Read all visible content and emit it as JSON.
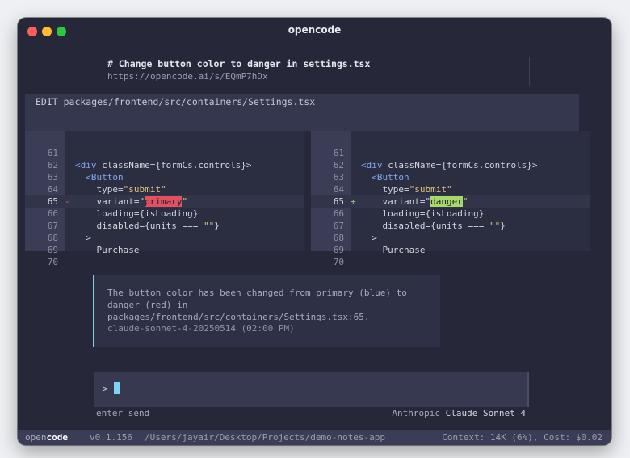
{
  "window": {
    "title": "opencode"
  },
  "message": {
    "title": "# Change button color to danger in settings.tsx",
    "share_url": "https://opencode.ai/s/EQmP7hDx"
  },
  "edit": {
    "header": "EDIT packages/frontend/src/containers/Settings.tsx"
  },
  "diff": {
    "left": [
      {
        "num": "61",
        "mark": "",
        "pre": "",
        "word": "",
        "post": ""
      },
      {
        "num": "62",
        "mark": "",
        "pre": "<div className={formCs.controls}>",
        "word": "",
        "post": ""
      },
      {
        "num": "63",
        "mark": "",
        "pre": "  <Button",
        "word": "",
        "post": ""
      },
      {
        "num": "64",
        "mark": "",
        "pre": "    type=\"submit\"",
        "word": "",
        "post": ""
      },
      {
        "num": "65",
        "mark": "-",
        "pre": "    variant=\"",
        "word": "primary",
        "post": "\""
      },
      {
        "num": "66",
        "mark": "",
        "pre": "    loading={isLoading}",
        "word": "",
        "post": ""
      },
      {
        "num": "67",
        "mark": "",
        "pre": "    disabled={units === \"\"}",
        "word": "",
        "post": ""
      },
      {
        "num": "68",
        "mark": "",
        "pre": "  >",
        "word": "",
        "post": ""
      },
      {
        "num": "69",
        "mark": "",
        "pre": "    Purchase",
        "word": "",
        "post": ""
      },
      {
        "num": "70",
        "mark": "",
        "pre": "",
        "word": "",
        "post": ""
      }
    ],
    "right": [
      {
        "num": "61",
        "mark": "",
        "pre": "",
        "word": "",
        "post": ""
      },
      {
        "num": "62",
        "mark": "",
        "pre": "<div className={formCs.controls}>",
        "word": "",
        "post": ""
      },
      {
        "num": "63",
        "mark": "",
        "pre": "  <Button",
        "word": "",
        "post": ""
      },
      {
        "num": "64",
        "mark": "",
        "pre": "    type=\"submit\"",
        "word": "",
        "post": ""
      },
      {
        "num": "65",
        "mark": "+",
        "pre": "    variant=\"",
        "word": "danger",
        "post": "\""
      },
      {
        "num": "66",
        "mark": "",
        "pre": "    loading={isLoading}",
        "word": "",
        "post": ""
      },
      {
        "num": "67",
        "mark": "",
        "pre": "    disabled={units === \"\"}",
        "word": "",
        "post": ""
      },
      {
        "num": "68",
        "mark": "",
        "pre": "  >",
        "word": "",
        "post": ""
      },
      {
        "num": "69",
        "mark": "",
        "pre": "    Purchase",
        "word": "",
        "post": ""
      },
      {
        "num": "70",
        "mark": "",
        "pre": "",
        "word": "",
        "post": ""
      }
    ]
  },
  "response": {
    "text": "The button color has been changed from primary (blue) to danger (red) in packages/frontend/src/containers/Settings.tsx:65.",
    "meta": "claude-sonnet-4-20250514 (02:00 PM)"
  },
  "input": {
    "prompt": ">",
    "value": ""
  },
  "footer": {
    "hint": "enter send",
    "provider": "Anthropic",
    "model": "Claude Sonnet 4"
  },
  "status": {
    "brand_prefix": "open",
    "brand_suffix": "code",
    "version": "v0.1.156",
    "path": "/Users/jayair/Desktop/Projects/demo-notes-app",
    "context": "Context: 14K (6%), Cost: $0.02"
  },
  "colors": {
    "background": "#262839",
    "accent": "#7ed3f2",
    "removed": "#e0525f",
    "added": "#a6d96a"
  }
}
